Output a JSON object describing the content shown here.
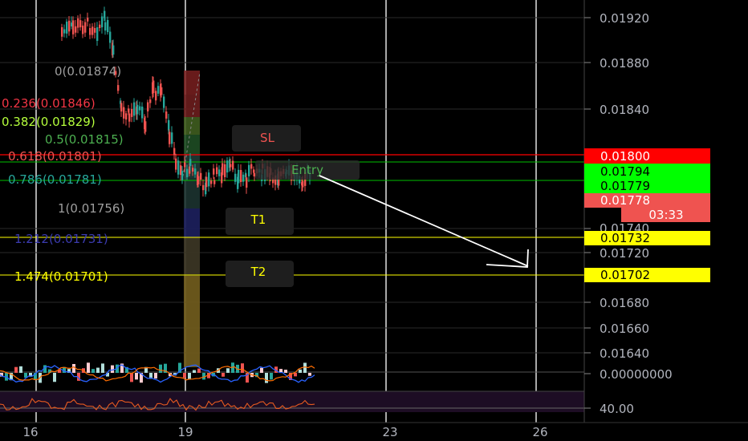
{
  "price_axis": {
    "ticks": [
      "0.01920",
      "0.01880",
      "0.01840",
      "0.01740",
      "0.01720",
      "0.01680",
      "0.01660",
      "0.01640"
    ],
    "badges": [
      {
        "price": "0.01800",
        "bg": "#ff0000",
        "fg": "#ffffff"
      },
      {
        "price": "0.01794",
        "bg": "#00ff00",
        "fg": "#000000"
      },
      {
        "price": "0.01779",
        "bg": "#00ff00",
        "fg": "#000000"
      },
      {
        "price": "0.01778",
        "bg": "#ef5350",
        "fg": "#ffffff"
      },
      {
        "timer": "03:33",
        "bg": "#ef5350",
        "fg": "#ffffff"
      },
      {
        "price": "0.01732",
        "bg": "#ffff00",
        "fg": "#000000"
      },
      {
        "price": "0.01702",
        "bg": "#ffff00",
        "fg": "#000000"
      }
    ]
  },
  "fib_levels": [
    {
      "label": "0(0.01874)",
      "color": "#9e9e9e"
    },
    {
      "label": "0.236(0.01846)",
      "color": "#f23645"
    },
    {
      "label": "0.382(0.01829)",
      "color": "#b5ff3c"
    },
    {
      "label": "0.5(0.01815)",
      "color": "#4caf50"
    },
    {
      "label": "0.618(0.01801)",
      "color": "#ef5350"
    },
    {
      "label": "0.786(0.01781)",
      "color": "#26a69a"
    },
    {
      "label": "1(0.01756)",
      "color": "#9e9e9e"
    },
    {
      "label": "1.212(0.01731)",
      "color": "#3b3bb0"
    },
    {
      "label": "1.474(0.01701)",
      "color": "#ffff00"
    }
  ],
  "trade_labels": {
    "sl": "SL",
    "entry": "Entry",
    "t1": "T1",
    "t2": "T2"
  },
  "indicators": {
    "macd_value": "0.00000000",
    "rsi_value": "40.00"
  },
  "time_axis": [
    "16",
    "19",
    "23",
    "26"
  ],
  "colors": {
    "up": "#26a69a",
    "down": "#ef5350",
    "background": "#000000",
    "sl": "#ff0000",
    "entry": "#00ff00",
    "target": "#ffff00"
  }
}
